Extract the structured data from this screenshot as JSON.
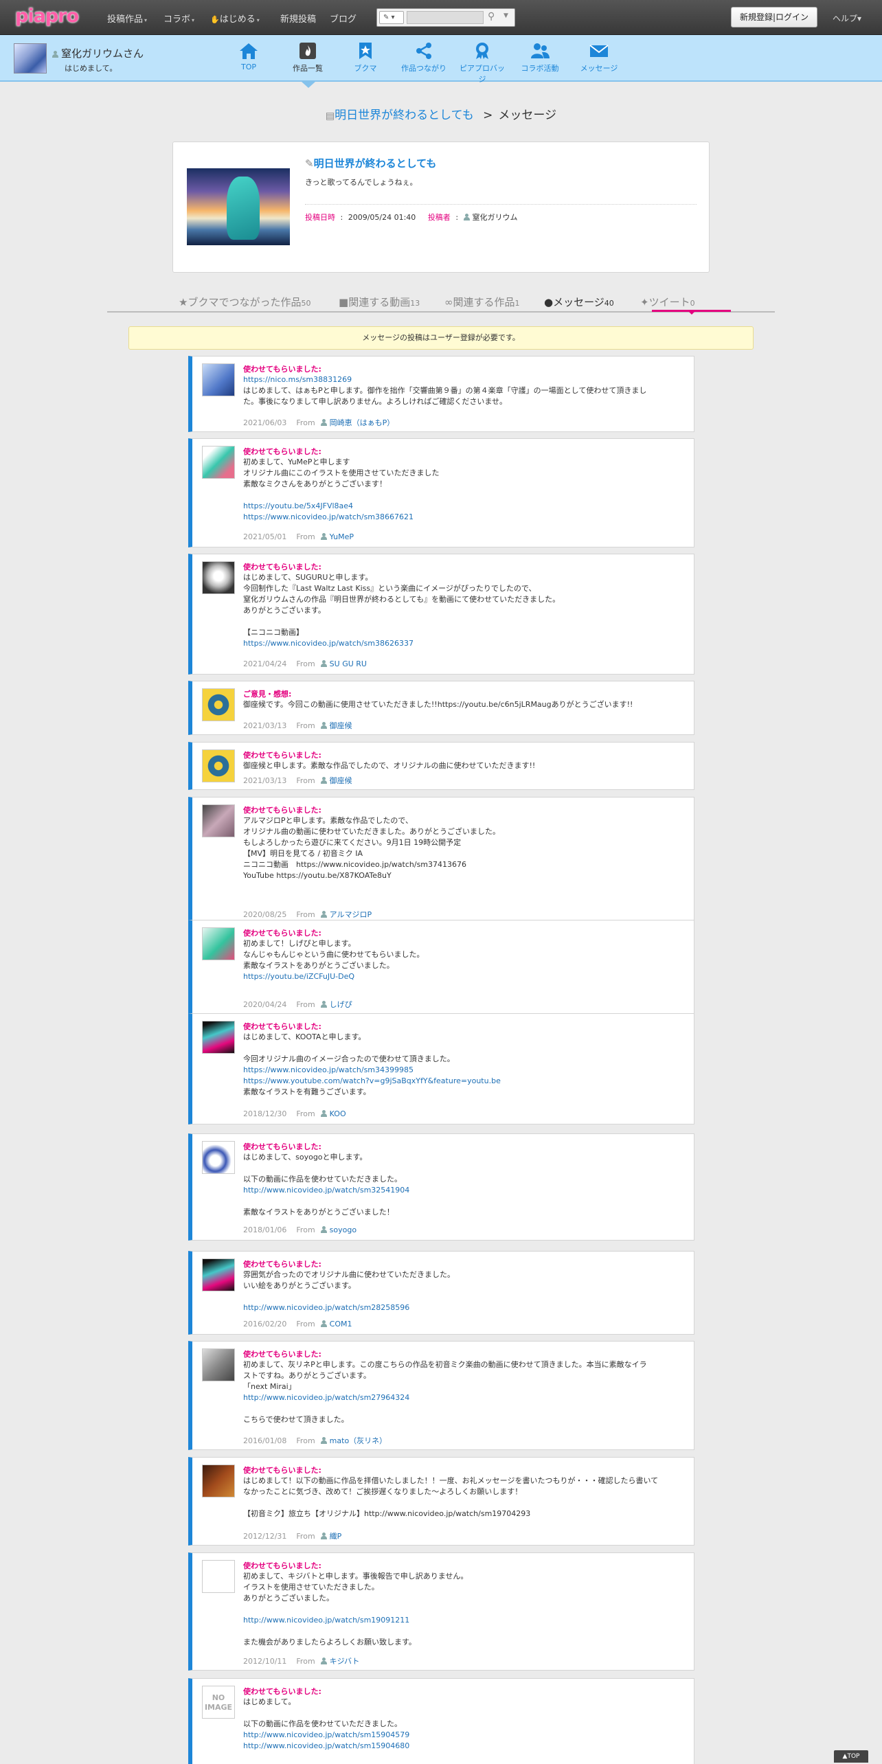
{
  "header": {
    "logo": "piapro",
    "nav": [
      {
        "label": "投稿作品",
        "caret": "▾"
      },
      {
        "label": "コラボ",
        "caret": "▾"
      },
      {
        "label": "はじめる",
        "caret": "▾"
      },
      {
        "label": "新規投稿",
        "caret": ""
      },
      {
        "label": "ブログ",
        "caret": ""
      }
    ],
    "search_type": "✎ ▾",
    "search_placeholder": "",
    "login_label": "新規登録|ログイン",
    "help_label": "ヘルプ▾"
  },
  "user": {
    "name": "窒化ガリウムさん",
    "message": "はじめまして。"
  },
  "user_tabs": [
    {
      "label": "TOP",
      "icon": "home-icon"
    },
    {
      "label": "作品一覧",
      "icon": "flame-icon"
    },
    {
      "label": "ブクマ",
      "icon": "bookmark-icon"
    },
    {
      "label": "作品つながり",
      "icon": "share-icon"
    },
    {
      "label": "ピアプロバッジ",
      "icon": "badge-icon"
    },
    {
      "label": "コラボ活動",
      "icon": "people-icon"
    },
    {
      "label": "メッセージ",
      "icon": "mail-icon"
    }
  ],
  "breadcrumb": {
    "work": "明日世界が終わるとしても",
    "sep": ">",
    "current": "メッセージ"
  },
  "work": {
    "title": "明日世界が終わるとしても",
    "description": "きっと歌ってるんでしょうねぇ。",
    "date_label": "投稿日時",
    "date": "2009/05/24 01:40",
    "author_label": "投稿者",
    "author": "窒化ガリウム"
  },
  "content_tabs": [
    {
      "label": "ブクマでつながった作品",
      "count": "50",
      "icon": "★"
    },
    {
      "label": "関連する動画",
      "count": "13",
      "icon": "■"
    },
    {
      "label": "関連する作品",
      "count": "1",
      "icon": "∞"
    },
    {
      "label": "メッセージ",
      "count": "40",
      "icon": "●"
    },
    {
      "label": "ツイート",
      "count": "0",
      "icon": "✦"
    }
  ],
  "notice": "メッセージの投稿はユーザー登録が必要です。",
  "messages": [
    {
      "title": "使わせてもらいました:",
      "lines": [
        [
          "https://nico.ms/sm38831269",
          true
        ],
        [
          "はじめまして、はぁもPと申します。御作を拙作「交響曲第９番」の第４楽章「守護」の一場面として使わせて頂きまし",
          false
        ],
        [
          "た。事後になりまして申し訳ありません。よろしければご確認くださいませ。",
          false
        ]
      ],
      "date": "2021/06/03",
      "from": "From",
      "author": "岡崎恵（はぁもP）"
    },
    {
      "title": "使わせてもらいました:",
      "lines": [
        [
          "初めまして、YuMePと申します",
          false
        ],
        [
          "オリジナル曲にこのイラストを使用させていただきました",
          false
        ],
        [
          "素敵なミクさんをありがとうございます！",
          false
        ],
        [
          "",
          false
        ],
        [
          "https://youtu.be/5x4JFVl8ae4",
          true
        ],
        [
          "https://www.nicovideo.jp/watch/sm38667621",
          true
        ]
      ],
      "date": "2021/05/01",
      "from": "From",
      "author": "YuMeP"
    },
    {
      "title": "使わせてもらいました:",
      "lines": [
        [
          "はじめまして、SUGURUと申します。",
          false
        ],
        [
          "今回制作した『Last Waltz Last Kiss』という楽曲にイメージがぴったりでしたので、",
          false
        ],
        [
          "窒化ガリウムさんの作品『明日世界が終わるとしても』を動画にて使わせていただきました。",
          false
        ],
        [
          "ありがとうございます。",
          false
        ],
        [
          "",
          false
        ],
        [
          "【ニコニコ動画】",
          false
        ],
        [
          "https://www.nicovideo.jp/watch/sm38626337",
          true
        ]
      ],
      "date": "2021/04/24",
      "from": "From",
      "author": "SU GU RU"
    },
    {
      "title": "ご意見・感想:",
      "lines": [
        [
          "御座候です。今回この動画に使用させていただきました!!https://youtu.be/c6n5jLRMaugありがとうございます!!",
          false
        ]
      ],
      "date": "2021/03/13",
      "from": "From",
      "author": "御座候"
    },
    {
      "title": "使わせてもらいました:",
      "lines": [
        [
          "御座候と申します。素敵な作品でしたので、オリジナルの曲に使わせていただきます!!",
          false
        ]
      ],
      "date": "2021/03/13",
      "from": "From",
      "author": "御座候"
    },
    {
      "title": "使わせてもらいました:",
      "lines": [
        [
          "アルマジロPと申します。素敵な作品でしたので、",
          false
        ],
        [
          "オリジナル曲の動画に使わせていただきました。ありがとうございました。",
          false
        ],
        [
          "もしよろしかったら遊びに来てください。9月1日 19時公開予定",
          false
        ],
        [
          "【MV】明日を見てる / 初音ミク IA",
          false
        ],
        [
          "ニコニコ動画　https://www.nicovideo.jp/watch/sm37413676",
          false
        ],
        [
          "YouTube https://youtu.be/X87KOATe8uY",
          false
        ]
      ],
      "date": "2020/08/25",
      "from": "From",
      "author": "アルマジロP"
    },
    {
      "title": "使わせてもらいました:",
      "lines": [
        [
          "初めまして！しげぴと申します。",
          false
        ],
        [
          "なんじゃもんじゃという曲に使わせてもらいました。",
          false
        ],
        [
          "素敵なイラストをありがとうございました。",
          false
        ],
        [
          "https://youtu.be/iZCFuJU-DeQ",
          true
        ]
      ],
      "date": "2020/04/24",
      "from": "From",
      "author": "しげぴ"
    },
    {
      "title": "使わせてもらいました:",
      "lines": [
        [
          "はじめまして、KOOTAと申します。",
          false
        ],
        [
          "",
          false
        ],
        [
          "今回オリジナル曲のイメージ合ったので使わせて頂きました。",
          false
        ],
        [
          "https://www.nicovideo.jp/watch/sm34399985",
          true
        ],
        [
          "https://www.youtube.com/watch?v=g9jSaBqxYfY&feature=youtu.be",
          true
        ],
        [
          "素敵なイラストを有難うございます。",
          false
        ]
      ],
      "date": "2018/12/30",
      "from": "From",
      "author": "KOO"
    },
    {
      "title": "使わせてもらいました:",
      "lines": [
        [
          "はじめまして、soyogoと申します。",
          false
        ],
        [
          "",
          false
        ],
        [
          "以下の動画に作品を使わせていただきました。",
          false
        ],
        [
          "http://www.nicovideo.jp/watch/sm32541904",
          true
        ],
        [
          "",
          false
        ],
        [
          "素敵なイラストをありがとうございました！",
          false
        ]
      ],
      "date": "2018/01/06",
      "from": "From",
      "author": "soyogo"
    },
    {
      "title": "使わせてもらいました:",
      "lines": [
        [
          "雰囲気が合ったのでオリジナル曲に使わせていただきました。",
          false
        ],
        [
          "いい絵をありがとうございます。",
          false
        ],
        [
          "",
          false
        ],
        [
          "http://www.nicovideo.jp/watch/sm28258596",
          true
        ]
      ],
      "date": "2016/02/20",
      "from": "From",
      "author": "COM1"
    },
    {
      "title": "使わせてもらいました:",
      "lines": [
        [
          "初めまして、灰リネPと申します。この度こちらの作品を初音ミク楽曲の動画に使わせて頂きました。本当に素敵なイラ",
          false
        ],
        [
          "ストですね。ありがとうございます。",
          false
        ],
        [
          "「next Mirai」",
          false
        ],
        [
          "http://www.nicovideo.jp/watch/sm27964324",
          true
        ],
        [
          "",
          false
        ],
        [
          "こちらで使わせて頂きました。",
          false
        ]
      ],
      "date": "2016/01/08",
      "from": "From",
      "author": "mato（灰リネ）"
    },
    {
      "title": "使わせてもらいました:",
      "lines": [
        [
          "はじめまして！以下の動画に作品を拝借いたしました！！一度、お礼メッセージを書いたつもりが・・・確認したら書いて",
          false
        ],
        [
          "なかったことに気づき、改めて！ご挨拶遅くなりました～よろしくお願いします！",
          false
        ],
        [
          "",
          false
        ],
        [
          "【初音ミク】旅立ち【オリジナル】http://www.nicovideo.jp/watch/sm19704293",
          false
        ]
      ],
      "date": "2012/12/31",
      "from": "From",
      "author": "織P"
    },
    {
      "title": "使わせてもらいました:",
      "lines": [
        [
          "初めまして、キジバトと申します。事後報告で申し訳ありません。",
          false
        ],
        [
          "イラストを使用させていただきました。",
          false
        ],
        [
          "ありがとうございました。",
          false
        ],
        [
          "",
          false
        ],
        [
          "http://www.nicovideo.jp/watch/sm19091211",
          true
        ],
        [
          "",
          false
        ],
        [
          "また機会がありましたらよろしくお願い致します。",
          false
        ]
      ],
      "date": "2012/10/11",
      "from": "From",
      "author": "キジバト"
    },
    {
      "title": "使わせてもらいました:",
      "lines": [
        [
          "はじめまして。",
          false
        ],
        [
          "",
          false
        ],
        [
          "以下の動画に作品を使わせていただきました。",
          false
        ],
        [
          "http://www.nicovideo.jp/watch/sm15904579",
          true
        ],
        [
          "http://www.nicovideo.jp/watch/sm15904680",
          true
        ]
      ],
      "date": "",
      "from": "",
      "author": ""
    }
  ],
  "noimage_label": "NO IMAGE",
  "totop_label": "▲TOP"
}
